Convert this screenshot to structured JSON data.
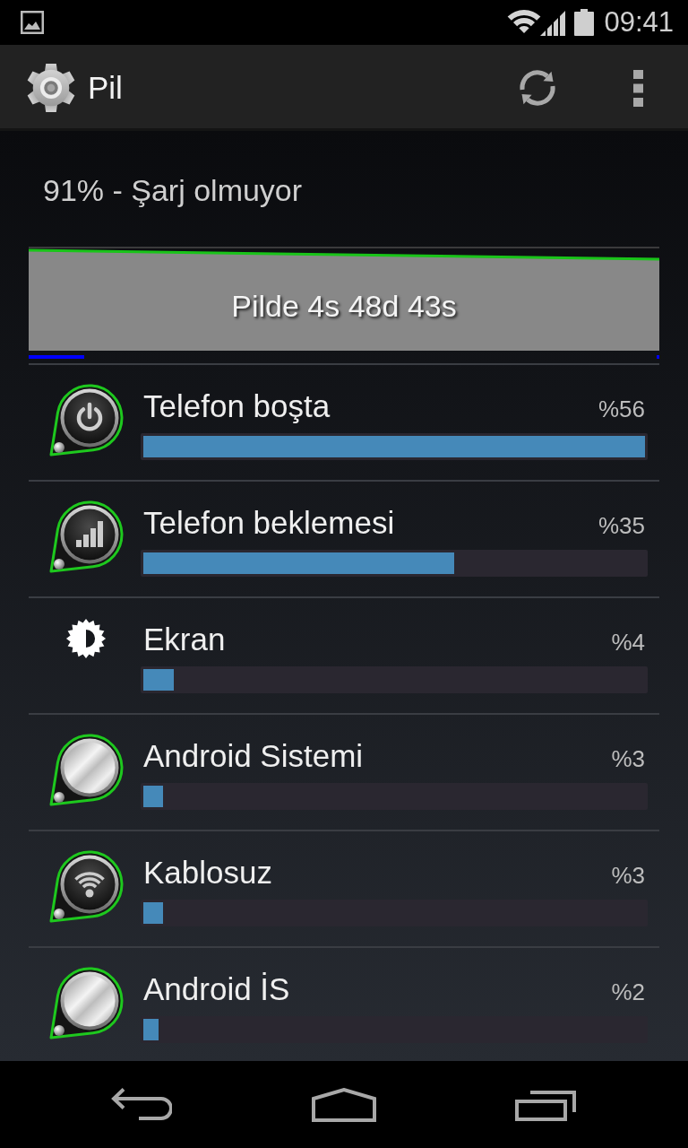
{
  "status_bar": {
    "time": "09:41"
  },
  "action_bar": {
    "title": "Pil"
  },
  "summary": {
    "status": "91% - Şarj olmuyor"
  },
  "history_graph": {
    "label": "Pilde 4s 48d 43s"
  },
  "usage": [
    {
      "kind": "idle",
      "name": "Telefon boşta",
      "percent": "%56",
      "level": 1
    },
    {
      "kind": "cell",
      "name": "Telefon beklemesi",
      "percent": "%35",
      "level": 0.62
    },
    {
      "kind": "screen",
      "name": "Ekran",
      "percent": "%4",
      "level": 0.06
    },
    {
      "kind": "app",
      "name": "Android Sistemi",
      "percent": "%3",
      "level": 0.04
    },
    {
      "kind": "wifi",
      "name": "Kablosuz",
      "percent": "%3",
      "level": 0.04
    },
    {
      "kind": "app",
      "name": "Android İS",
      "percent": "%2",
      "level": 0.03
    }
  ]
}
